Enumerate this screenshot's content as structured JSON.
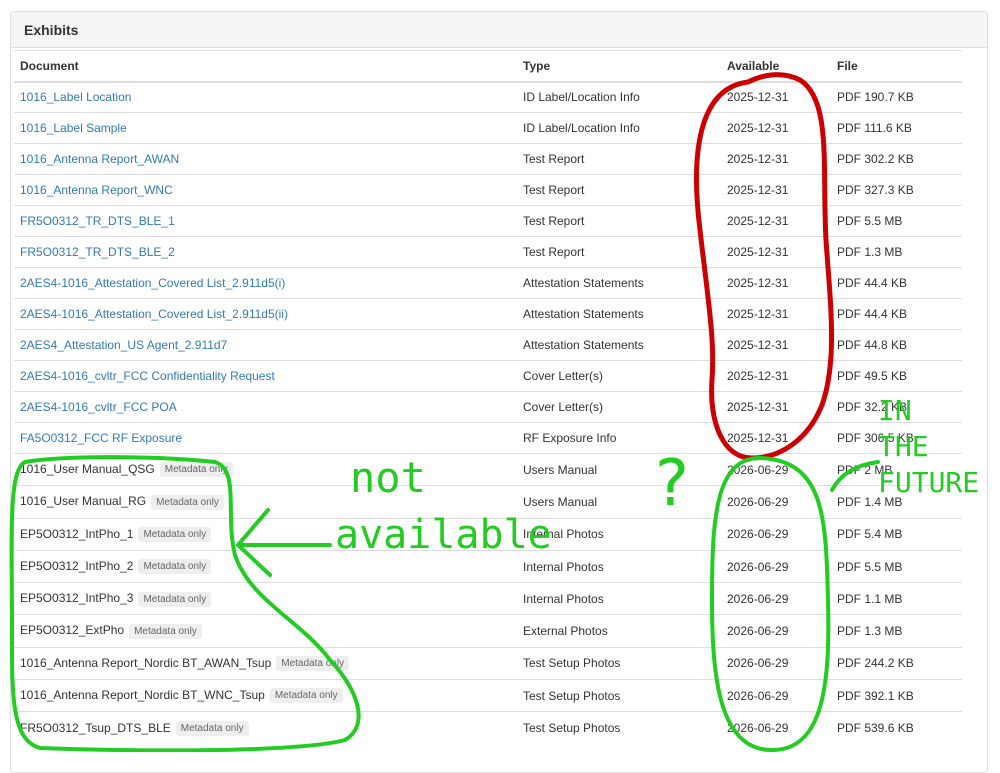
{
  "panel": {
    "title": "Exhibits"
  },
  "table": {
    "headers": {
      "document": "Document",
      "type": "Type",
      "available": "Available",
      "file": "File"
    },
    "rows": [
      {
        "document": "1016_Label Location",
        "type": "ID Label/Location Info",
        "available": "2025-12-31",
        "file": "PDF 190.7 KB"
      },
      {
        "document": "1016_Label Sample",
        "type": "ID Label/Location Info",
        "available": "2025-12-31",
        "file": "PDF 111.6 KB"
      },
      {
        "document": "1016_Antenna Report_AWAN",
        "type": "Test Report",
        "available": "2025-12-31",
        "file": "PDF 302.2 KB"
      },
      {
        "document": "1016_Antenna Report_WNC",
        "type": "Test Report",
        "available": "2025-12-31",
        "file": "PDF 327.3 KB"
      },
      {
        "document": "FR5O0312_TR_DTS_BLE_1",
        "type": "Test Report",
        "available": "2025-12-31",
        "file": "PDF 5.5 MB"
      },
      {
        "document": "FR5O0312_TR_DTS_BLE_2",
        "type": "Test Report",
        "available": "2025-12-31",
        "file": "PDF 1.3 MB"
      },
      {
        "document": "2AES4-1016_Attestation_Covered List_2.911d5(i)",
        "type": "Attestation Statements",
        "available": "2025-12-31",
        "file": "PDF 44.4 KB"
      },
      {
        "document": "2AES4-1016_Attestation_Covered List_2.911d5(ii)",
        "type": "Attestation Statements",
        "available": "2025-12-31",
        "file": "PDF 44.4 KB"
      },
      {
        "document": "2AES4_Attestation_US Agent_2.911d7",
        "type": "Attestation Statements",
        "available": "2025-12-31",
        "file": "PDF 44.8 KB"
      },
      {
        "document": "2AES4-1016_cvltr_FCC Confidentiality Request",
        "type": "Cover Letter(s)",
        "available": "2025-12-31",
        "file": "PDF 49.5 KB"
      },
      {
        "document": "2AES4-1016_cvltr_FCC POA",
        "type": "Cover Letter(s)",
        "available": "2025-12-31",
        "file": "PDF 32.2 KB"
      },
      {
        "document": "FA5O0312_FCC RF Exposure",
        "type": "RF Exposure Info",
        "available": "2025-12-31",
        "file": "PDF 306.5 KB"
      },
      {
        "document": "1016_User Manual_QSG",
        "badge": "Metadata only",
        "type": "Users Manual",
        "available": "2026-06-29",
        "file": "PDF 2 MB"
      },
      {
        "document": "1016_User Manual_RG",
        "badge": "Metadata only",
        "type": "Users Manual",
        "available": "2026-06-29",
        "file": "PDF 1.4 MB"
      },
      {
        "document": "EP5O0312_IntPho_1",
        "badge": "Metadata only",
        "type": "Internal Photos",
        "available": "2026-06-29",
        "file": "PDF 5.4 MB"
      },
      {
        "document": "EP5O0312_IntPho_2",
        "badge": "Metadata only",
        "type": "Internal Photos",
        "available": "2026-06-29",
        "file": "PDF 5.5 MB"
      },
      {
        "document": "EP5O0312_IntPho_3",
        "badge": "Metadata only",
        "type": "Internal Photos",
        "available": "2026-06-29",
        "file": "PDF 1.1 MB"
      },
      {
        "document": "EP5O0312_ExtPho",
        "badge": "Metadata only",
        "type": "External Photos",
        "available": "2026-06-29",
        "file": "PDF 1.3 MB"
      },
      {
        "document": "1016_Antenna Report_Nordic BT_AWAN_Tsup",
        "badge": "Metadata only",
        "type": "Test Setup Photos",
        "available": "2026-06-29",
        "file": "PDF 244.2 KB"
      },
      {
        "document": "1016_Antenna Report_Nordic BT_WNC_Tsup",
        "badge": "Metadata only",
        "type": "Test Setup Photos",
        "available": "2026-06-29",
        "file": "PDF 392.1 KB"
      },
      {
        "document": "FR5O0312_Tsup_DTS_BLE",
        "badge": "Metadata only",
        "type": "Test Setup Photos",
        "available": "2026-06-29",
        "file": "PDF 539.6 KB"
      }
    ]
  },
  "annotations": {
    "not_available_line1": "not",
    "not_available_line2": "available",
    "question": "?",
    "future_line1": "IN",
    "future_line2": "THE",
    "future_line3": "FUTURE",
    "red": "#cc0000",
    "green": "#22cc22"
  },
  "colors": {
    "link": "#337ab7",
    "badge_bg": "#eeeeee",
    "border": "#dddddd",
    "heading_bg": "#f5f5f5"
  }
}
